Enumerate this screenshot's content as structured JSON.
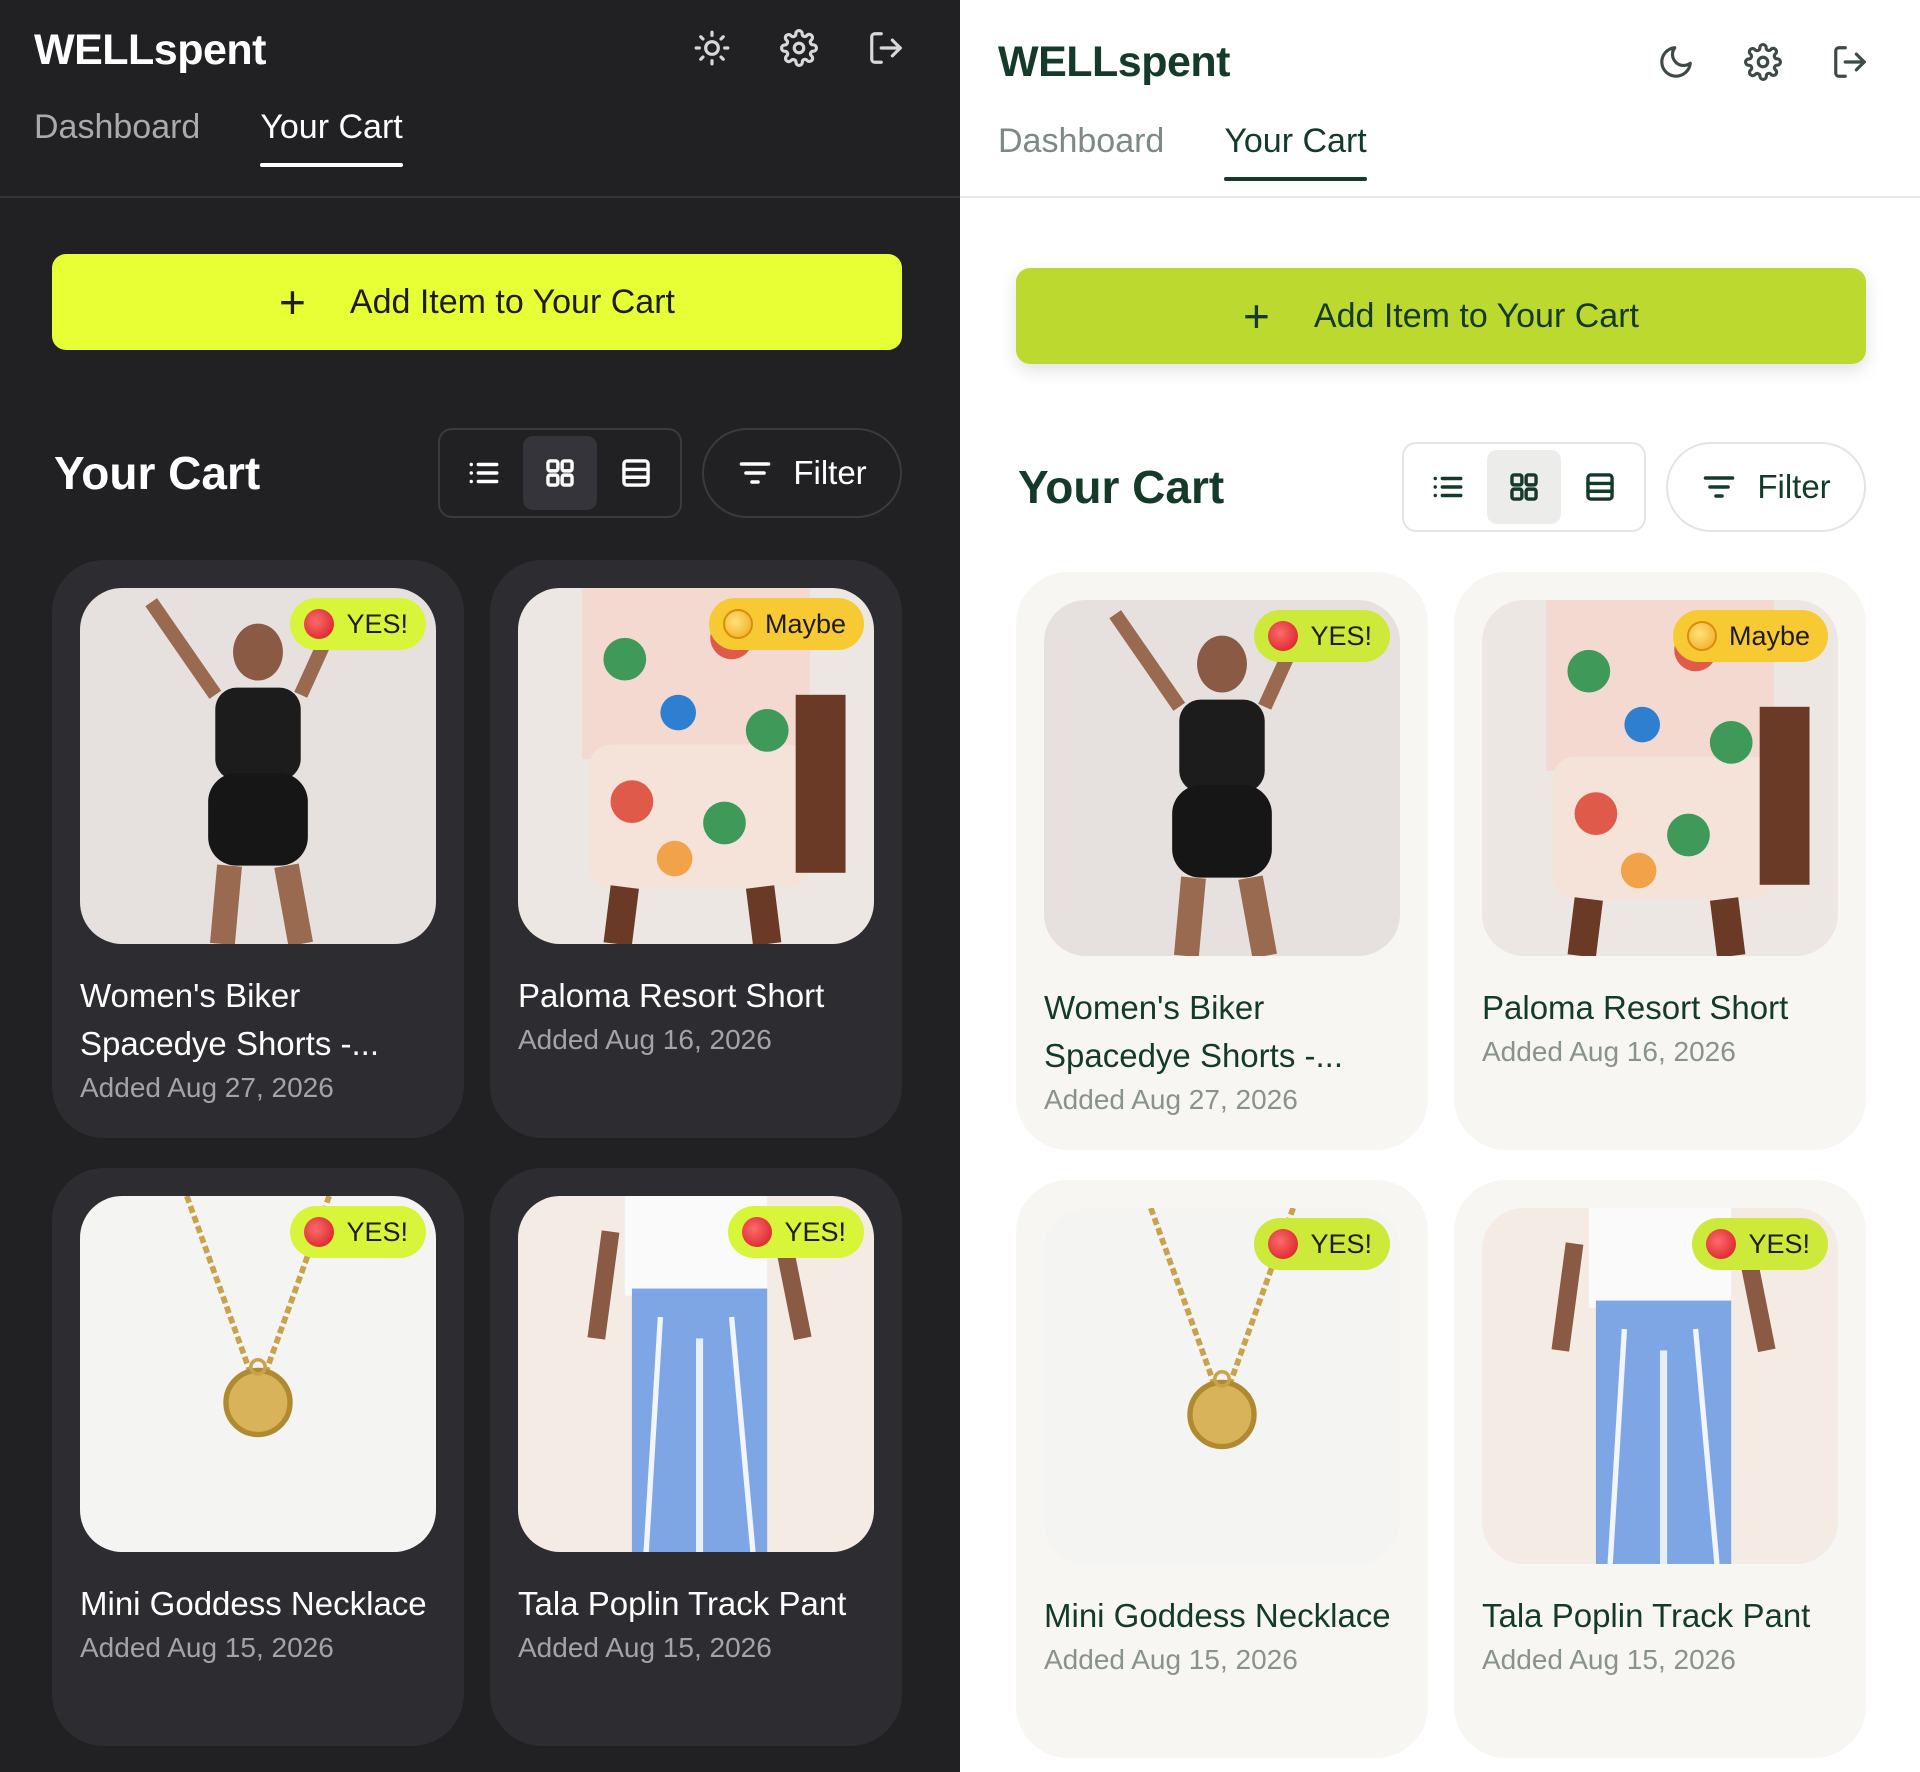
{
  "app": {
    "name": "WELLspent"
  },
  "header": {
    "tabs": [
      {
        "label": "Dashboard"
      },
      {
        "label": "Your Cart"
      }
    ]
  },
  "actions": {
    "add_item_label": "Add Item to Your Cart"
  },
  "cart": {
    "title": "Your Cart",
    "filter_label": "Filter",
    "items": [
      {
        "title": "Women's Biker Spacedye Shorts -...",
        "date": "Added Aug 27, 2026",
        "badge": "YES!"
      },
      {
        "title": "Paloma Resort Short",
        "date": "Added Aug 16, 2026",
        "badge": "Maybe"
      },
      {
        "title": "Mini Goddess Necklace",
        "date": "Added Aug 15, 2026",
        "badge": "YES!"
      },
      {
        "title": "Tala Poplin Track Pant",
        "date": "Added Aug 15, 2026",
        "badge": "YES!"
      }
    ]
  },
  "colors": {
    "dark_bg": "#212124",
    "dark_card": "#2d2d31",
    "dark_accent": "#e7ff35",
    "light_bg": "#ffffff",
    "light_card": "#f7f6f2",
    "light_accent": "#bcd92f",
    "light_text": "#143a2a",
    "badge_yes": "#d9f53a",
    "badge_maybe": "#f7c932"
  }
}
